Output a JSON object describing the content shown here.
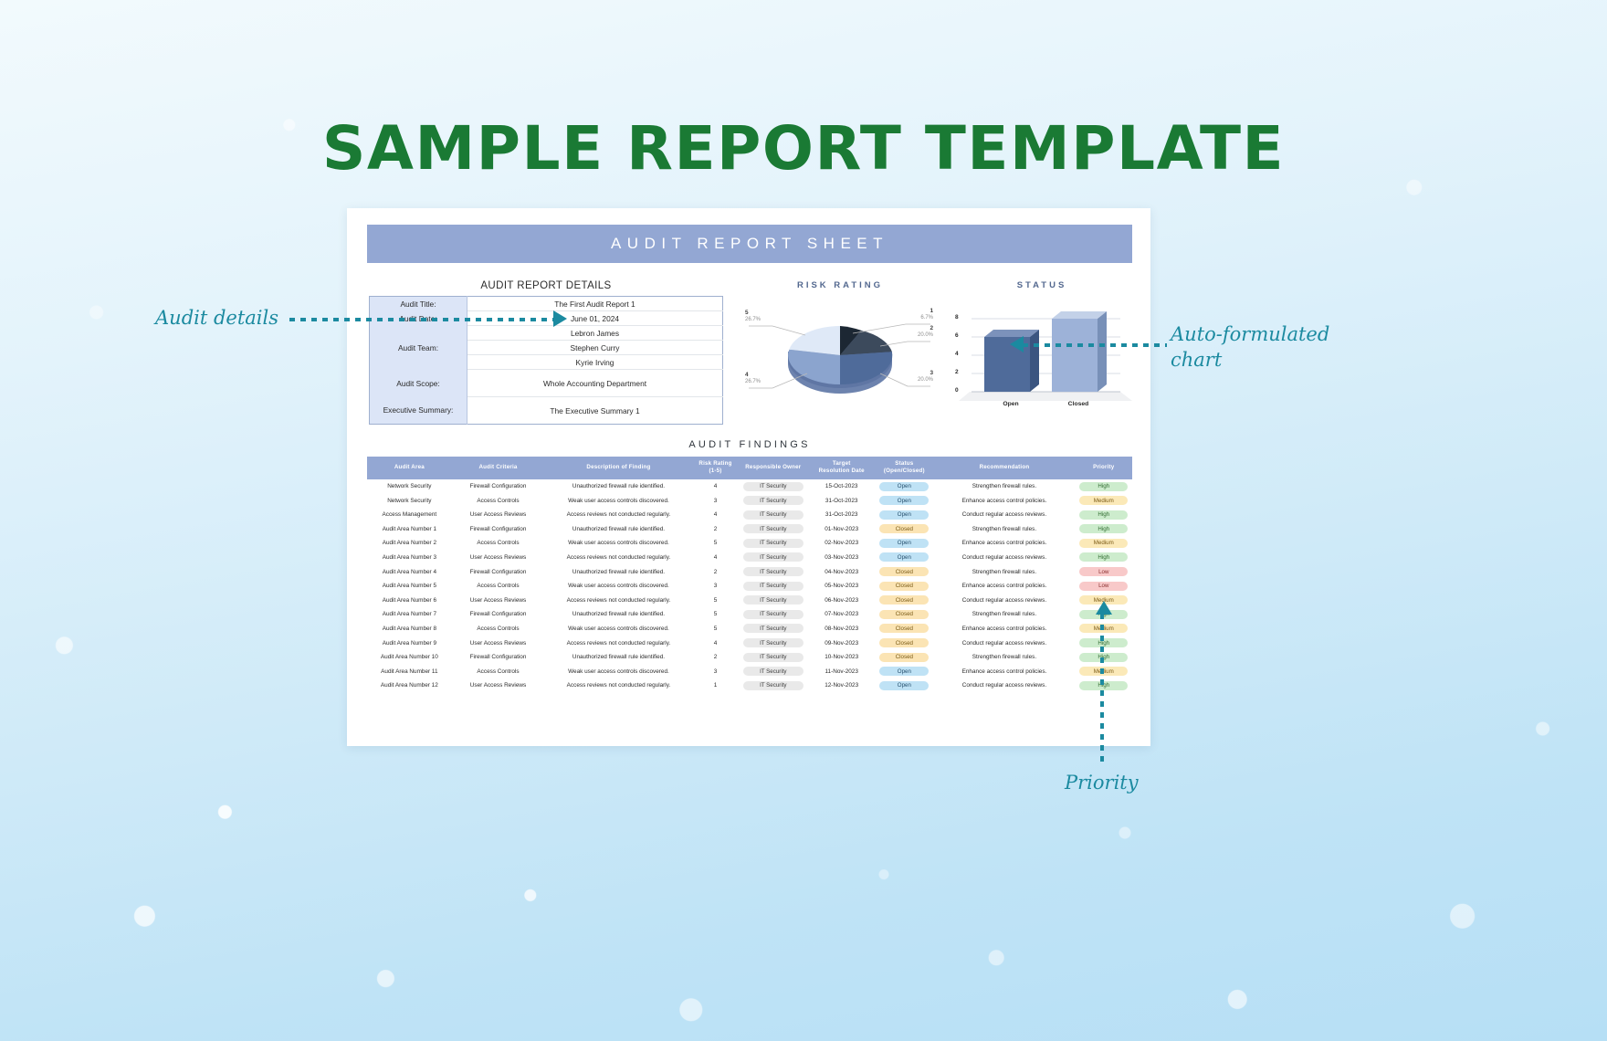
{
  "page_title": "SAMPLE REPORT TEMPLATE",
  "sheet": {
    "banner_title": "AUDIT REPORT SHEET",
    "details_caption": "AUDIT REPORT DETAILS",
    "findings_caption": "AUDIT FINDINGS"
  },
  "details": {
    "rows": [
      {
        "key": "Audit Title:",
        "value": "The First Audit Report 1"
      },
      {
        "key": "Audit Date:",
        "value": "June 01, 2024"
      },
      {
        "key": "Audit Team:",
        "value": "Lebron James"
      },
      {
        "key": "",
        "value": "Stephen Curry"
      },
      {
        "key": "",
        "value": "Kyrie Irving"
      },
      {
        "key": "Audit Scope:",
        "value": "Whole Accounting Department"
      },
      {
        "key": "Executive Summary:",
        "value": "The Executive Summary 1"
      }
    ]
  },
  "chart_data": [
    {
      "type": "pie",
      "title": "RISK RATING",
      "categories": [
        "1",
        "2",
        "3",
        "4",
        "5"
      ],
      "values": [
        6.7,
        20.0,
        20.0,
        26.7,
        26.7
      ],
      "labels": [
        "6.7%",
        "20.0%",
        "20.0%",
        "26.7%",
        "26.7%"
      ],
      "colors": [
        "#1c2733",
        "#3c4a5c",
        "#4f6b9a",
        "#8ba4ce",
        "#dfe9f7"
      ],
      "legend": "data-labels",
      "grid": false
    },
    {
      "type": "bar",
      "title": "STATUS",
      "categories": [
        "Open",
        "Closed"
      ],
      "values": [
        6,
        8
      ],
      "ylabel": "",
      "xlabel": "",
      "ylim": [
        0,
        8
      ],
      "yticks": [
        "0",
        "2",
        "4",
        "6",
        "8"
      ],
      "colors": [
        "#4f6b9a",
        "#9db2d8"
      ],
      "grid": true
    }
  ],
  "findings": {
    "columns": [
      "Audit Area",
      "Audit Criteria",
      "Description of Finding",
      "Risk Rating\n(1-5)",
      "Responsible Owner",
      "Target\nResolution Date",
      "Status\n(Open/Closed)",
      "Recommendation",
      "Priority"
    ],
    "rows": [
      [
        "Network Security",
        "Firewall Configuration",
        "Unauthorized firewall rule identified.",
        "4",
        "IT Security",
        "15-Oct-2023",
        "Open",
        "Strengthen firewall rules.",
        "High"
      ],
      [
        "Network Security",
        "Access Controls",
        "Weak user access controls discovered.",
        "3",
        "IT Security",
        "31-Oct-2023",
        "Open",
        "Enhance access control policies.",
        "Medium"
      ],
      [
        "Access Management",
        "User Access Reviews",
        "Access reviews not conducted regularly.",
        "4",
        "IT Security",
        "31-Oct-2023",
        "Open",
        "Conduct regular access reviews.",
        "High"
      ],
      [
        "Audit Area Number 1",
        "Firewall Configuration",
        "Unauthorized firewall rule identified.",
        "2",
        "IT Security",
        "01-Nov-2023",
        "Closed",
        "Strengthen firewall rules.",
        "High"
      ],
      [
        "Audit Area Number 2",
        "Access Controls",
        "Weak user access controls discovered.",
        "5",
        "IT Security",
        "02-Nov-2023",
        "Open",
        "Enhance access control policies.",
        "Medium"
      ],
      [
        "Audit Area Number 3",
        "User Access Reviews",
        "Access reviews not conducted regularly.",
        "4",
        "IT Security",
        "03-Nov-2023",
        "Open",
        "Conduct regular access reviews.",
        "High"
      ],
      [
        "Audit Area Number 4",
        "Firewall Configuration",
        "Unauthorized firewall rule identified.",
        "2",
        "IT Security",
        "04-Nov-2023",
        "Closed",
        "Strengthen firewall rules.",
        "Low"
      ],
      [
        "Audit Area Number 5",
        "Access Controls",
        "Weak user access controls discovered.",
        "3",
        "IT Security",
        "05-Nov-2023",
        "Closed",
        "Enhance access control policies.",
        "Low"
      ],
      [
        "Audit Area Number 6",
        "User Access Reviews",
        "Access reviews not conducted regularly.",
        "5",
        "IT Security",
        "06-Nov-2023",
        "Closed",
        "Conduct regular access reviews.",
        "Medium"
      ],
      [
        "Audit Area Number 7",
        "Firewall Configuration",
        "Unauthorized firewall rule identified.",
        "5",
        "IT Security",
        "07-Nov-2023",
        "Closed",
        "Strengthen firewall rules.",
        "High"
      ],
      [
        "Audit Area Number 8",
        "Access Controls",
        "Weak user access controls discovered.",
        "5",
        "IT Security",
        "08-Nov-2023",
        "Closed",
        "Enhance access control policies.",
        "Medium"
      ],
      [
        "Audit Area Number 9",
        "User Access Reviews",
        "Access reviews not conducted regularly.",
        "4",
        "IT Security",
        "09-Nov-2023",
        "Closed",
        "Conduct regular access reviews.",
        "High"
      ],
      [
        "Audit Area Number 10",
        "Firewall Configuration",
        "Unauthorized firewall rule identified.",
        "2",
        "IT Security",
        "10-Nov-2023",
        "Closed",
        "Strengthen firewall rules.",
        "High"
      ],
      [
        "Audit Area Number 11",
        "Access Controls",
        "Weak user access controls discovered.",
        "3",
        "IT Security",
        "11-Nov-2023",
        "Open",
        "Enhance access control policies.",
        "Medium"
      ],
      [
        "Audit Area Number 12",
        "User Access Reviews",
        "Access reviews not conducted regularly.",
        "1",
        "IT Security",
        "12-Nov-2023",
        "Open",
        "Conduct regular access reviews.",
        "High"
      ]
    ]
  },
  "annotations": {
    "audit_details": "Audit details",
    "auto_chart_line1": "Auto-formulated",
    "auto_chart_line2": "chart",
    "priority": "Priority"
  },
  "colors": {
    "title_green": "#1a7a34",
    "banner_blue": "#93a7d3",
    "annotation_teal": "#1b8aa0"
  }
}
